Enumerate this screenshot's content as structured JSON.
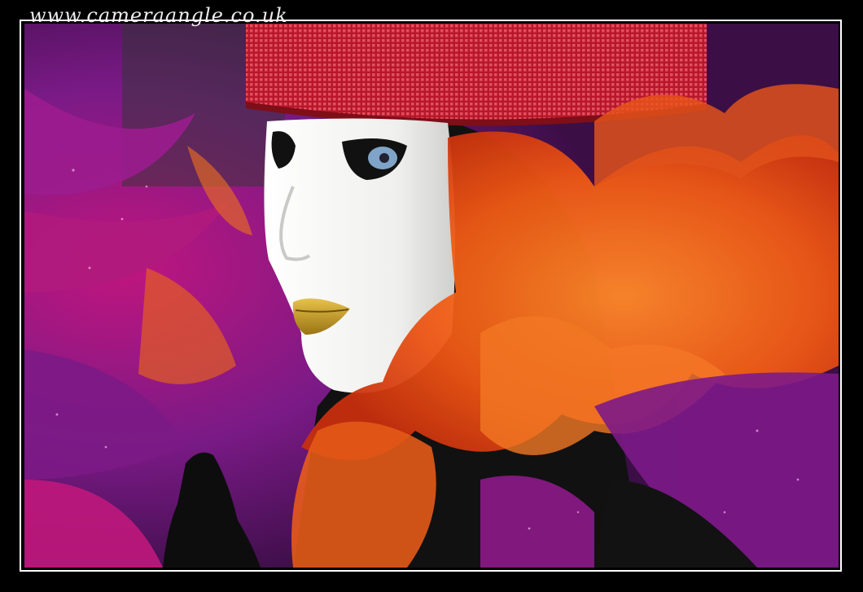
{
  "watermark": {
    "text": "www.cameraangle.co.uk"
  },
  "photo": {
    "subject": "carnival-mask-portrait",
    "colors": {
      "frame": "#ffffff",
      "background": "#000000",
      "mask": "#f4f4f2",
      "lips": "#c9a227",
      "hat": "#c8202c",
      "orange_tulle": "#f26a1b",
      "purple_feathers": "#8a1f8c",
      "magenta": "#c2187a",
      "glove": "#0d0d0d"
    }
  }
}
